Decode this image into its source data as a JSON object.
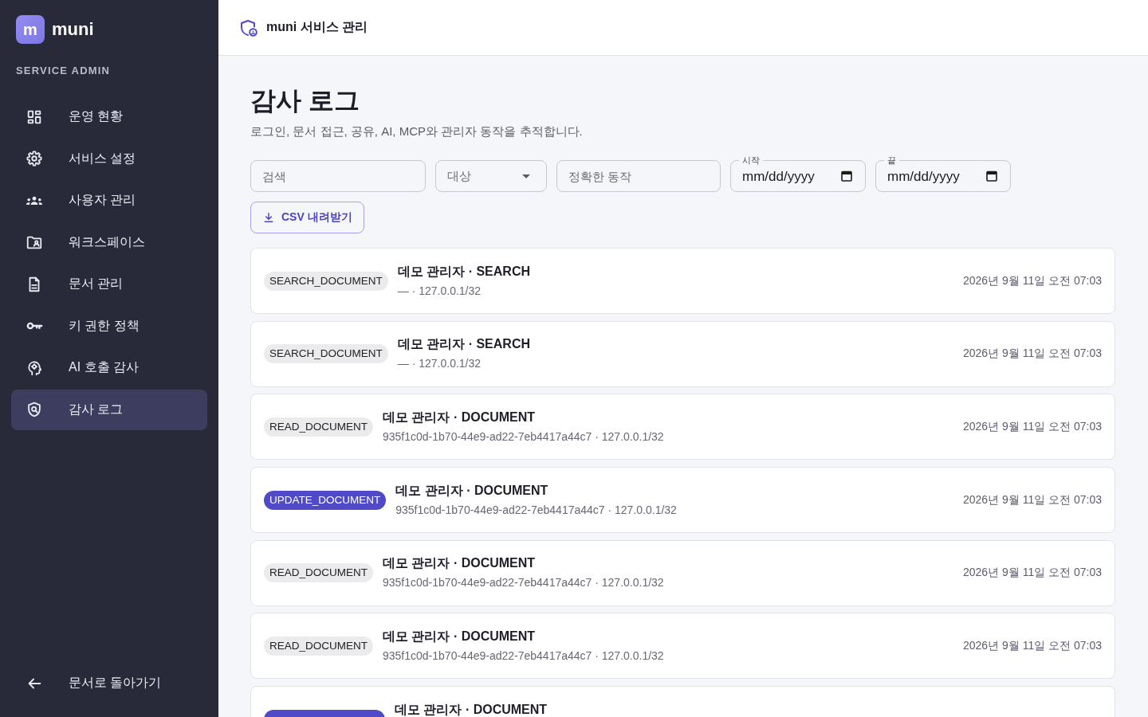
{
  "sidebar": {
    "logo": {
      "mark": "m",
      "name": "muni"
    },
    "section_label": "SERVICE ADMIN",
    "items": [
      {
        "label": "운영 현황",
        "selected": false
      },
      {
        "label": "서비스 설정",
        "selected": false
      },
      {
        "label": "사용자 관리",
        "selected": false
      },
      {
        "label": "워크스페이스",
        "selected": false
      },
      {
        "label": "문서 관리",
        "selected": false
      },
      {
        "label": "키 권한 정책",
        "selected": false
      },
      {
        "label": "AI 호출 감사",
        "selected": false
      },
      {
        "label": "감사 로그",
        "selected": true
      }
    ],
    "back_link": "문서로 돌아가기"
  },
  "header": {
    "title": "muni 서비스 관리"
  },
  "page": {
    "title": "감사 로그",
    "subtitle": "로그인, 문서 접근, 공유, AI, MCP와 관리자 동작을 추적합니다."
  },
  "filters": [
    {
      "kind": "text",
      "placeholder": "검색"
    },
    {
      "kind": "select",
      "placeholder": "대상"
    },
    {
      "kind": "text",
      "placeholder": "정확한 동작"
    },
    {
      "kind": "date",
      "label": "시작",
      "value": "mm/dd/yyyy"
    },
    {
      "kind": "date",
      "label": "끝",
      "value": "mm/dd/yyyy"
    }
  ],
  "export_button": {
    "label": "CSV 내려받기"
  },
  "log_entries": [
    {
      "kind": "read",
      "action": "SEARCH_DOCUMENT",
      "title": "데모 관리자 · SEARCH",
      "meta": "— · 127.0.0.1/32",
      "time": "2026년 9월 11일 오전 07:03"
    },
    {
      "kind": "read",
      "action": "SEARCH_DOCUMENT",
      "title": "데모 관리자 · SEARCH",
      "meta": "— · 127.0.0.1/32",
      "time": "2026년 9월 11일 오전 07:03"
    },
    {
      "kind": "read",
      "action": "READ_DOCUMENT",
      "title": "데모 관리자 · DOCUMENT",
      "meta": "935f1c0d-1b70-44e9-ad22-7eb4417a44c7 · 127.0.0.1/32",
      "time": "2026년 9월 11일 오전 07:03"
    },
    {
      "kind": "write",
      "action": "UPDATE_DOCUMENT",
      "title": "데모 관리자 · DOCUMENT",
      "meta": "935f1c0d-1b70-44e9-ad22-7eb4417a44c7 · 127.0.0.1/32",
      "time": "2026년 9월 11일 오전 07:03"
    },
    {
      "kind": "read",
      "action": "READ_DOCUMENT",
      "title": "데모 관리자 · DOCUMENT",
      "meta": "935f1c0d-1b70-44e9-ad22-7eb4417a44c7 · 127.0.0.1/32",
      "time": "2026년 9월 11일 오전 07:03"
    },
    {
      "kind": "read",
      "action": "READ_DOCUMENT",
      "title": "데모 관리자 · DOCUMENT",
      "meta": "935f1c0d-1b70-44e9-ad22-7eb4417a44c7 · 127.0.0.1/32",
      "time": "2026년 9월 11일 오전 07:03"
    },
    {
      "kind": "write",
      "title": "데모 관리자 · DOCUMENT"
    }
  ]
}
